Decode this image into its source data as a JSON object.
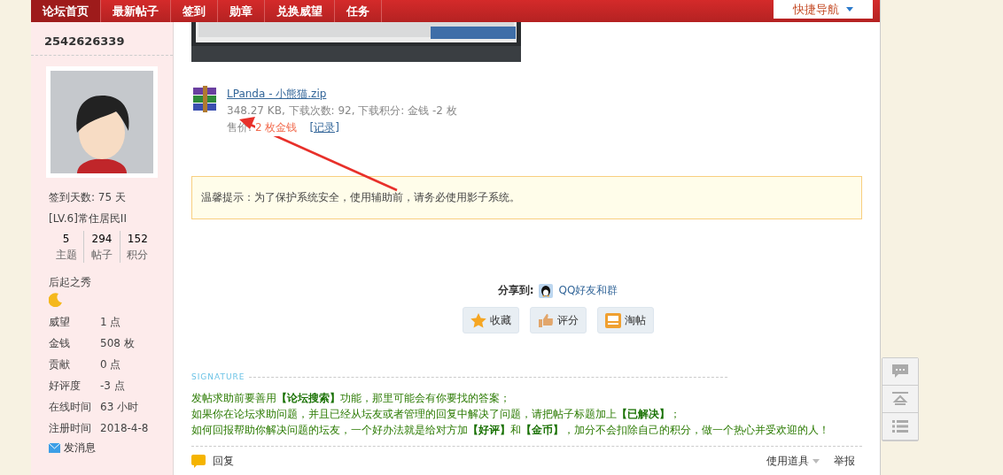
{
  "nav": {
    "items": [
      {
        "label": "论坛首页",
        "selected": true
      },
      {
        "label": "最新帖子",
        "selected": false
      },
      {
        "label": "签到",
        "selected": false
      },
      {
        "label": "勋章",
        "selected": false
      },
      {
        "label": "兑换威望",
        "selected": false
      },
      {
        "label": "任务",
        "selected": false
      }
    ],
    "quick_nav": "快捷导航"
  },
  "profile": {
    "username": "2542626339",
    "checkin": "签到天数: 75 天",
    "level": "[LV.6]常住居民II",
    "stats": [
      {
        "value": "5",
        "label": "主题"
      },
      {
        "value": "294",
        "label": "帖子"
      },
      {
        "value": "152",
        "label": "积分"
      }
    ],
    "rank": "后起之秀",
    "fields": [
      {
        "label": "威望",
        "value": "1 点"
      },
      {
        "label": "金钱",
        "value": "508 枚"
      },
      {
        "label": "贡献",
        "value": "0 点"
      },
      {
        "label": "好评度",
        "value": "-3 点"
      },
      {
        "label": "在线时间",
        "value": "63 小时"
      },
      {
        "label": "注册时间",
        "value": "2018-4-8"
      }
    ],
    "message": "发消息"
  },
  "attachment": {
    "name": "LPanda - 小熊猫.zip",
    "meta": "348.27 KB, 下载次数: 92, 下载积分: 金钱 -2 枚",
    "price_label": "售价:",
    "price": "2 枚金钱",
    "record": "[记录]"
  },
  "tip": "温馨提示：为了保护系统安全，使用辅助前，请务必使用影子系统。",
  "share": {
    "label": "分享到:",
    "target": "QQ好友和群"
  },
  "actions": [
    {
      "kind": "star",
      "label": "收藏"
    },
    {
      "kind": "thumb",
      "label": "评分"
    },
    {
      "kind": "tray",
      "label": "淘帖"
    }
  ],
  "signature": {
    "heading": "SIGNATURE",
    "lines": [
      "发帖求助前要善用**【论坛搜索】**功能，那里可能会有你要找的答案；",
      "如果你在论坛求助问题，并且已经从坛友或者管理的回复中解决了问题，请把帖子标题加上**【已解决】**；",
      "如何回报帮助你解决问题的坛友，一个好办法就是给对方加**【好评】**和**【金币】**，加分不会扣除自己的积分，做一个热心并受欢迎的人！"
    ]
  },
  "footer": {
    "reply": "回复",
    "tools": "使用道具",
    "report": "举报"
  },
  "side_tools": [
    {
      "kind": "comment"
    },
    {
      "kind": "top"
    },
    {
      "kind": "list"
    }
  ]
}
